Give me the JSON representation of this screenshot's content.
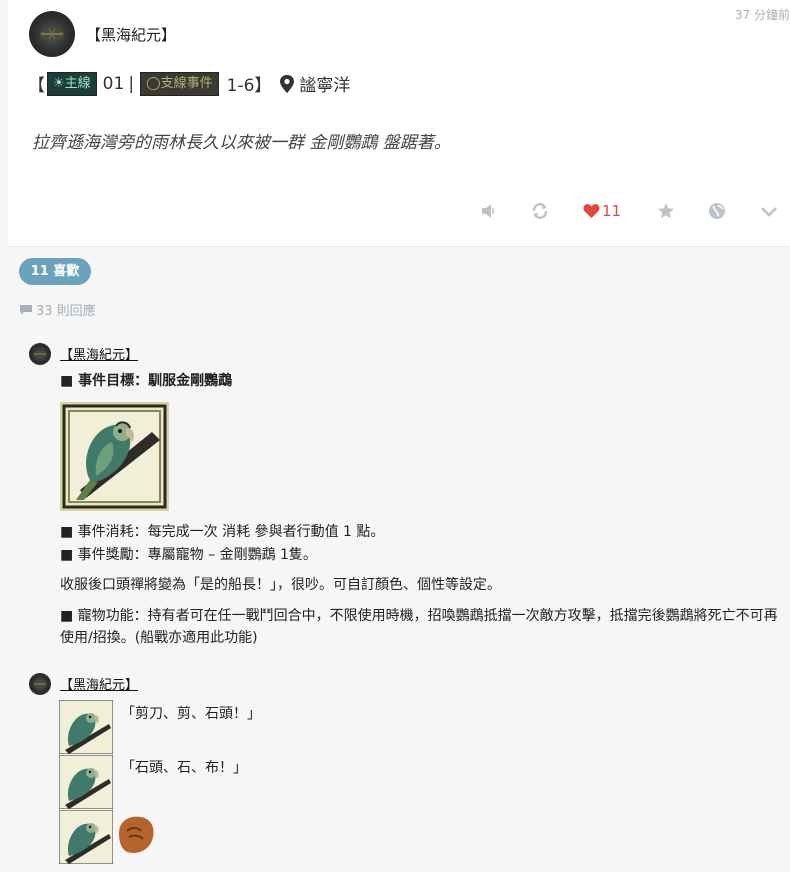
{
  "post": {
    "timestamp": "37 分鐘前",
    "author": "【黑海紀元】",
    "headline": {
      "bracket_open": "【",
      "tag_main": "主線",
      "main_number": "01",
      "separator": "|",
      "tag_side": "支線事件",
      "side_number": "1-6】",
      "location": "謐寧洋"
    },
    "subtitle": "拉齊遜海灣旁的雨林長久以來被一群 金剛鸚鵡 盤踞著。",
    "like_count": "11"
  },
  "likes_badge": "11 喜歡",
  "replies_label": "33 則回應",
  "comments": [
    {
      "author": "【黑海紀元】",
      "objective": "■ 事件目標：馴服金剛鸚鵡",
      "cost": "■ 事件消耗：每完成一次 消耗 參與者行動值 1 點。",
      "reward": "■ 事件獎勵：專屬寵物 – 金剛鸚鵡 1隻。",
      "note": "收服後口頭禪將變為「是的船長！」，很吵。可自訂顏色、個性等設定。",
      "pet_function": "■ 寵物功能：持有者可在任一戰鬥回合中，不限使用時機，招喚鸚鵡抵擋一次敵方攻擊，抵擋完後鸚鵡將死亡不可再使用/招換。(船戰亦適用此功能)"
    },
    {
      "author": "【黑海紀元】",
      "quote1": "「剪刀、剪、石頭！」",
      "quote2": "「石頭、石、布！」"
    }
  ],
  "colors": {
    "accent": "#6ba4ba",
    "like": "#e2493a",
    "tag_main_bg": "#1d3d3a",
    "tag_side_bg": "#3a3a30"
  },
  "icons": [
    "mute-icon",
    "repost-icon",
    "heart-icon",
    "star-icon",
    "globe-icon",
    "chevron-down-icon",
    "pin-icon",
    "comment-bubble-icon",
    "parrot-image",
    "fist-sticker"
  ]
}
